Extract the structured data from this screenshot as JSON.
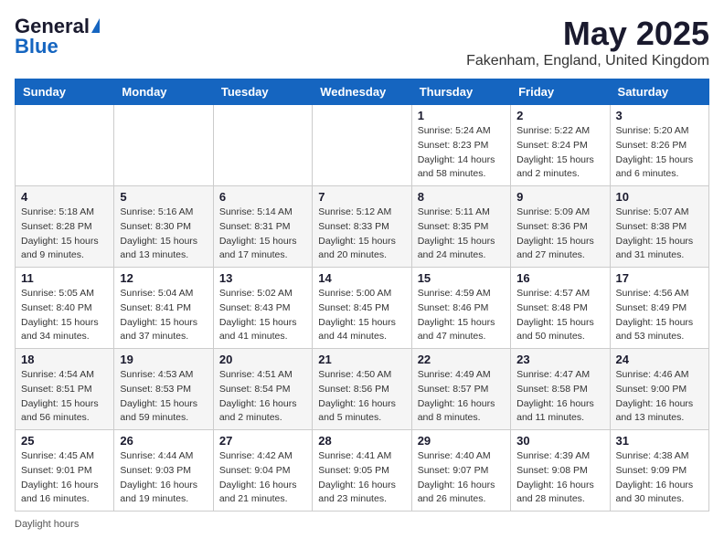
{
  "header": {
    "logo_general": "General",
    "logo_blue": "Blue",
    "month_title": "May 2025",
    "location": "Fakenham, England, United Kingdom"
  },
  "days_of_week": [
    "Sunday",
    "Monday",
    "Tuesday",
    "Wednesday",
    "Thursday",
    "Friday",
    "Saturday"
  ],
  "footer_note": "Daylight hours",
  "weeks": [
    [
      {
        "day": "",
        "info": ""
      },
      {
        "day": "",
        "info": ""
      },
      {
        "day": "",
        "info": ""
      },
      {
        "day": "",
        "info": ""
      },
      {
        "day": "1",
        "info": "Sunrise: 5:24 AM\nSunset: 8:23 PM\nDaylight: 14 hours\nand 58 minutes."
      },
      {
        "day": "2",
        "info": "Sunrise: 5:22 AM\nSunset: 8:24 PM\nDaylight: 15 hours\nand 2 minutes."
      },
      {
        "day": "3",
        "info": "Sunrise: 5:20 AM\nSunset: 8:26 PM\nDaylight: 15 hours\nand 6 minutes."
      }
    ],
    [
      {
        "day": "4",
        "info": "Sunrise: 5:18 AM\nSunset: 8:28 PM\nDaylight: 15 hours\nand 9 minutes."
      },
      {
        "day": "5",
        "info": "Sunrise: 5:16 AM\nSunset: 8:30 PM\nDaylight: 15 hours\nand 13 minutes."
      },
      {
        "day": "6",
        "info": "Sunrise: 5:14 AM\nSunset: 8:31 PM\nDaylight: 15 hours\nand 17 minutes."
      },
      {
        "day": "7",
        "info": "Sunrise: 5:12 AM\nSunset: 8:33 PM\nDaylight: 15 hours\nand 20 minutes."
      },
      {
        "day": "8",
        "info": "Sunrise: 5:11 AM\nSunset: 8:35 PM\nDaylight: 15 hours\nand 24 minutes."
      },
      {
        "day": "9",
        "info": "Sunrise: 5:09 AM\nSunset: 8:36 PM\nDaylight: 15 hours\nand 27 minutes."
      },
      {
        "day": "10",
        "info": "Sunrise: 5:07 AM\nSunset: 8:38 PM\nDaylight: 15 hours\nand 31 minutes."
      }
    ],
    [
      {
        "day": "11",
        "info": "Sunrise: 5:05 AM\nSunset: 8:40 PM\nDaylight: 15 hours\nand 34 minutes."
      },
      {
        "day": "12",
        "info": "Sunrise: 5:04 AM\nSunset: 8:41 PM\nDaylight: 15 hours\nand 37 minutes."
      },
      {
        "day": "13",
        "info": "Sunrise: 5:02 AM\nSunset: 8:43 PM\nDaylight: 15 hours\nand 41 minutes."
      },
      {
        "day": "14",
        "info": "Sunrise: 5:00 AM\nSunset: 8:45 PM\nDaylight: 15 hours\nand 44 minutes."
      },
      {
        "day": "15",
        "info": "Sunrise: 4:59 AM\nSunset: 8:46 PM\nDaylight: 15 hours\nand 47 minutes."
      },
      {
        "day": "16",
        "info": "Sunrise: 4:57 AM\nSunset: 8:48 PM\nDaylight: 15 hours\nand 50 minutes."
      },
      {
        "day": "17",
        "info": "Sunrise: 4:56 AM\nSunset: 8:49 PM\nDaylight: 15 hours\nand 53 minutes."
      }
    ],
    [
      {
        "day": "18",
        "info": "Sunrise: 4:54 AM\nSunset: 8:51 PM\nDaylight: 15 hours\nand 56 minutes."
      },
      {
        "day": "19",
        "info": "Sunrise: 4:53 AM\nSunset: 8:53 PM\nDaylight: 15 hours\nand 59 minutes."
      },
      {
        "day": "20",
        "info": "Sunrise: 4:51 AM\nSunset: 8:54 PM\nDaylight: 16 hours\nand 2 minutes."
      },
      {
        "day": "21",
        "info": "Sunrise: 4:50 AM\nSunset: 8:56 PM\nDaylight: 16 hours\nand 5 minutes."
      },
      {
        "day": "22",
        "info": "Sunrise: 4:49 AM\nSunset: 8:57 PM\nDaylight: 16 hours\nand 8 minutes."
      },
      {
        "day": "23",
        "info": "Sunrise: 4:47 AM\nSunset: 8:58 PM\nDaylight: 16 hours\nand 11 minutes."
      },
      {
        "day": "24",
        "info": "Sunrise: 4:46 AM\nSunset: 9:00 PM\nDaylight: 16 hours\nand 13 minutes."
      }
    ],
    [
      {
        "day": "25",
        "info": "Sunrise: 4:45 AM\nSunset: 9:01 PM\nDaylight: 16 hours\nand 16 minutes."
      },
      {
        "day": "26",
        "info": "Sunrise: 4:44 AM\nSunset: 9:03 PM\nDaylight: 16 hours\nand 19 minutes."
      },
      {
        "day": "27",
        "info": "Sunrise: 4:42 AM\nSunset: 9:04 PM\nDaylight: 16 hours\nand 21 minutes."
      },
      {
        "day": "28",
        "info": "Sunrise: 4:41 AM\nSunset: 9:05 PM\nDaylight: 16 hours\nand 23 minutes."
      },
      {
        "day": "29",
        "info": "Sunrise: 4:40 AM\nSunset: 9:07 PM\nDaylight: 16 hours\nand 26 minutes."
      },
      {
        "day": "30",
        "info": "Sunrise: 4:39 AM\nSunset: 9:08 PM\nDaylight: 16 hours\nand 28 minutes."
      },
      {
        "day": "31",
        "info": "Sunrise: 4:38 AM\nSunset: 9:09 PM\nDaylight: 16 hours\nand 30 minutes."
      }
    ]
  ]
}
